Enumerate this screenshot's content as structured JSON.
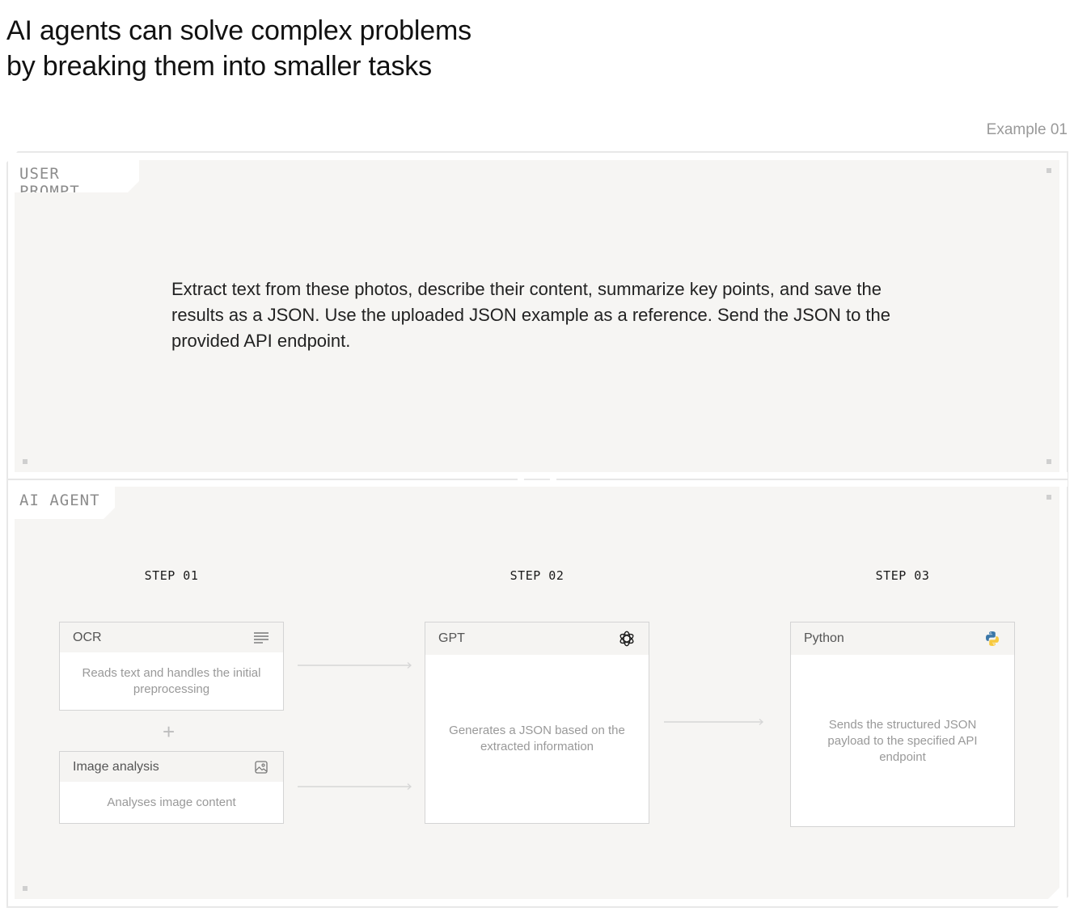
{
  "headline": {
    "line1": "AI agents can solve complex problems",
    "line2": "by breaking them into smaller tasks"
  },
  "example_label": "Example 01",
  "user_prompt": {
    "tab_label": "USER PROMPT",
    "text": "Extract text from these photos, describe their content, summarize key points, and save the results as a JSON. Use the uploaded JSON example as a reference. Send the JSON to the provided API endpoint."
  },
  "ai_agent": {
    "tab_label": "AI AGENT",
    "steps": [
      {
        "label": "STEP 01"
      },
      {
        "label": "STEP 02"
      },
      {
        "label": "STEP 03"
      }
    ],
    "cards": {
      "ocr": {
        "title": "OCR",
        "icon": "text-lines-icon",
        "description": "Reads text and handles the initial preprocessing"
      },
      "image_analysis": {
        "title": "Image analysis",
        "icon": "image-icon",
        "description": "Analyses image content"
      },
      "gpt": {
        "title": "GPT",
        "icon": "openai-logo-icon",
        "description": "Generates a JSON based on the extracted information"
      },
      "python": {
        "title": "Python",
        "icon": "python-logo-icon",
        "description": "Sends the structured JSON payload to the specified API endpoint"
      }
    },
    "combine_symbol": "+"
  },
  "colors": {
    "panel_bg": "#f6f5f3",
    "card_border": "#d4d4d4",
    "muted_text": "#999999",
    "python_blue": "#3b77a8",
    "python_yellow": "#f7c93e"
  }
}
